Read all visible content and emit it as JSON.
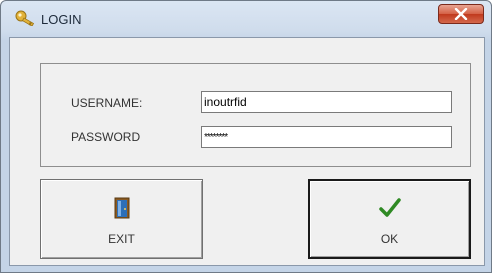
{
  "window": {
    "title": "LOGIN"
  },
  "form": {
    "username_label": "USERNAME:",
    "username_value": "inoutrfid",
    "password_label": "PASSWORD",
    "password_value": "********"
  },
  "buttons": {
    "exit_label": "EXIT",
    "ok_label": "OK"
  },
  "icons": {
    "app": "key-icon",
    "close": "close-icon",
    "exit": "door-icon",
    "ok": "checkmark-icon"
  },
  "colors": {
    "close_button": "#c0391d",
    "checkmark": "#2f8a24",
    "door": "#2d6fb8"
  }
}
